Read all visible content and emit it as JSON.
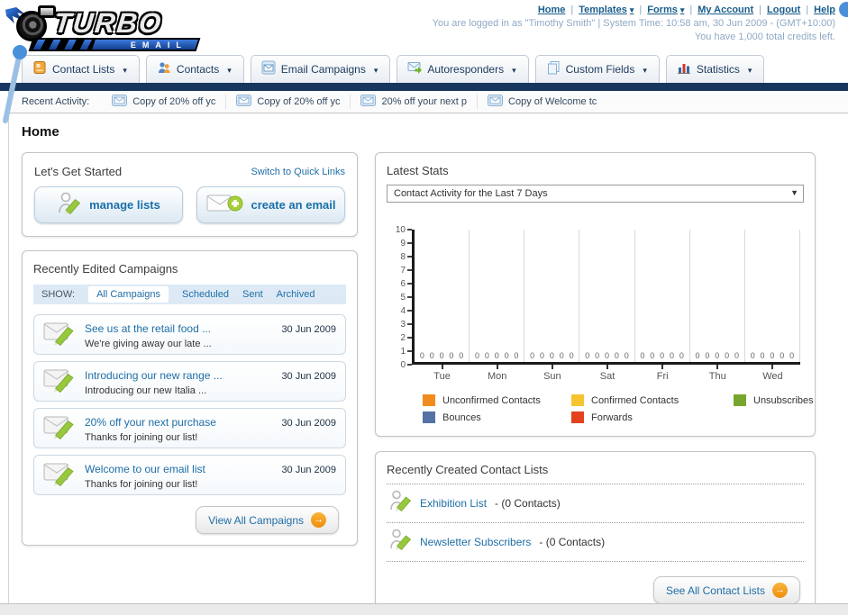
{
  "header": {
    "logo": {
      "brand": "TURBO",
      "sub": "EMAIL"
    },
    "separator": "|",
    "links": [
      {
        "label": "Home",
        "dropdown": false
      },
      {
        "label": "Templates",
        "dropdown": true
      },
      {
        "label": "Forms",
        "dropdown": true
      },
      {
        "label": "My Account",
        "dropdown": false
      },
      {
        "label": "Logout",
        "dropdown": false
      },
      {
        "label": "Help",
        "dropdown": false
      }
    ],
    "login_info": "You are logged in as \"Timothy Smith\" | System Time: 10:58 am, 30 Jun 2009 - (GMT+10:00)",
    "credits": "You have 1,000 total credits left."
  },
  "nav": {
    "tabs": [
      {
        "label": "Contact Lists",
        "icon": "address-book-icon"
      },
      {
        "label": "Contacts",
        "icon": "contacts-icon"
      },
      {
        "label": "Email Campaigns",
        "icon": "email-campaigns-icon"
      },
      {
        "label": "Autoresponders",
        "icon": "autoresponder-icon"
      },
      {
        "label": "Custom Fields",
        "icon": "custom-fields-icon"
      },
      {
        "label": "Statistics",
        "icon": "statistics-icon"
      }
    ]
  },
  "recent_activity": {
    "label": "Recent Activity:",
    "items": [
      "Copy of 20% off yc",
      "Copy of 20% off yc",
      "20% off your next p",
      "Copy of Welcome tc"
    ]
  },
  "page_title": "Home",
  "get_started": {
    "title": "Let's Get Started",
    "switch_link": "Switch to Quick Links",
    "buttons": [
      {
        "label": "manage lists",
        "icon": "person-pencil-icon"
      },
      {
        "label": "create an email",
        "icon": "envelope-plus-icon"
      }
    ]
  },
  "campaigns": {
    "title": "Recently Edited Campaigns",
    "show_label": "SHOW:",
    "filters": [
      {
        "label": "All Campaigns",
        "active": true
      },
      {
        "label": "Scheduled",
        "active": false
      },
      {
        "label": "Sent",
        "active": false
      },
      {
        "label": "Archived",
        "active": false
      }
    ],
    "rows": [
      {
        "title": "See us at the retail food ...",
        "subtitle": "We're giving away our late ...",
        "date": "30 Jun 2009"
      },
      {
        "title": "Introducing our new range ...",
        "subtitle": "Introducing our new Italia ...",
        "date": "30 Jun 2009"
      },
      {
        "title": "20% off your next purchase",
        "subtitle": "Thanks for joining our list!",
        "date": "30 Jun 2009"
      },
      {
        "title": "Welcome to our email list",
        "subtitle": "Thanks for joining our list!",
        "date": "30 Jun 2009"
      }
    ],
    "view_all_label": "View All Campaigns"
  },
  "stats": {
    "title": "Latest Stats",
    "dropdown_value": "Contact Activity for the Last 7 Days"
  },
  "chart_data": {
    "type": "bar",
    "title": "Contact Activity for the Last 7 Days",
    "categories": [
      "Tue",
      "Mon",
      "Sun",
      "Sat",
      "Fri",
      "Thu",
      "Wed"
    ],
    "series": [
      {
        "name": "Unconfirmed Contacts",
        "color": "#f28b1e",
        "values": [
          0,
          0,
          0,
          0,
          0,
          0,
          0
        ]
      },
      {
        "name": "Confirmed Contacts",
        "color": "#f6c431",
        "values": [
          0,
          0,
          0,
          0,
          0,
          0,
          0
        ]
      },
      {
        "name": "Unsubscribes",
        "color": "#77a62e",
        "values": [
          0,
          0,
          0,
          0,
          0,
          0,
          0
        ]
      },
      {
        "name": "Bounces",
        "color": "#5572a7",
        "values": [
          0,
          0,
          0,
          0,
          0,
          0,
          0
        ]
      },
      {
        "name": "Forwards",
        "color": "#e2431e",
        "values": [
          0,
          0,
          0,
          0,
          0,
          0,
          0
        ]
      }
    ],
    "xlabel": "",
    "ylabel": "",
    "ylim": [
      0,
      10
    ],
    "ytick_step": 1,
    "grid": "vertical",
    "legend_position": "bottom"
  },
  "contact_lists": {
    "title": "Recently Created Contact Lists",
    "rows": [
      {
        "name": "Exhibition List",
        "count": "- (0 Contacts)"
      },
      {
        "name": "Newsletter Subscribers",
        "count": "- (0 Contacts)"
      }
    ],
    "see_all_label": "See All Contact Lists"
  }
}
